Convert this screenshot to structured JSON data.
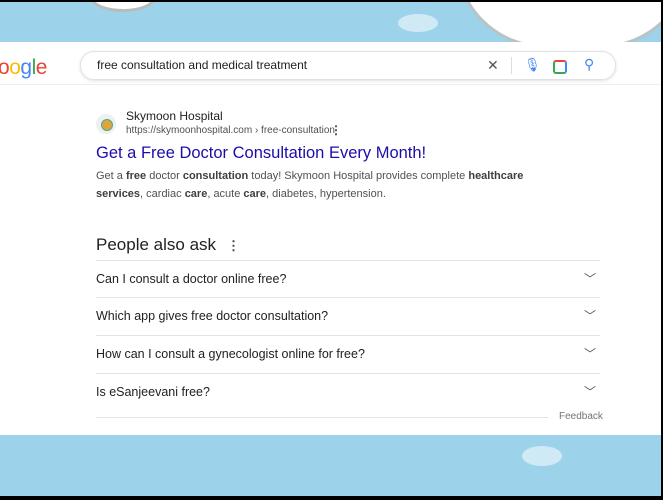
{
  "header": {
    "logo_text": "ogle",
    "query": "free consultation and medical treatment"
  },
  "result": {
    "site_name": "Skymoon Hospital",
    "url": "https://skymoonhospital.com › free-consultation",
    "title": "Get a Free Doctor Consultation Every Month!",
    "snippet": [
      {
        "t": "Get a "
      },
      {
        "t": "free",
        "b": true
      },
      {
        "t": " doctor "
      },
      {
        "t": "consultation",
        "b": true
      },
      {
        "t": " today! Skymoon Hospital provides complete "
      },
      {
        "t": "healthcare services",
        "b": true
      },
      {
        "t": ", cardiac "
      },
      {
        "t": "care",
        "b": true
      },
      {
        "t": ", acute "
      },
      {
        "t": "care",
        "b": true
      },
      {
        "t": ", diabetes, hypertension."
      }
    ]
  },
  "people_also_ask": {
    "heading": "People also ask",
    "questions": [
      "Can I consult a doctor online free?",
      "Which app gives free doctor consultation?",
      "How can I consult a gynecologist online for free?",
      "Is eSanjeevani free?"
    ],
    "feedback": "Feedback"
  }
}
